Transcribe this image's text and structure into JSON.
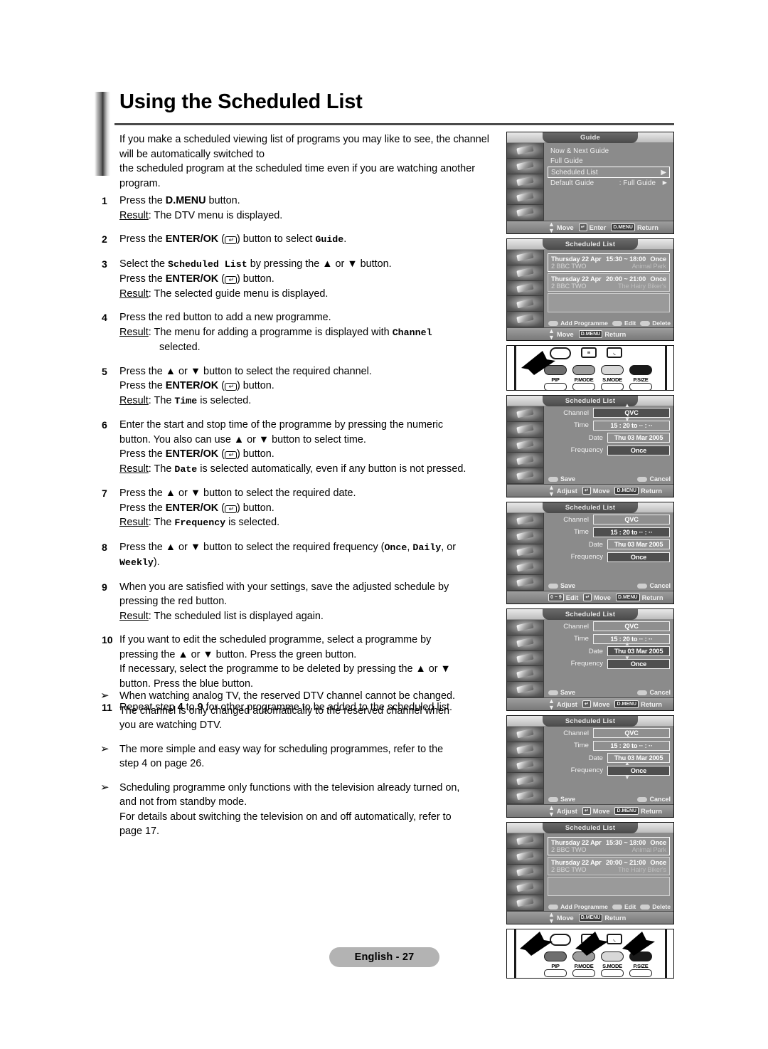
{
  "header": {
    "title": "Using the Scheduled List"
  },
  "intro": {
    "l1": "If you make a scheduled viewing list of programs you may like to see, the channel",
    "l2": "will be automatically switched to",
    "l3": "the scheduled program at the scheduled time even if  you are watching another",
    "l4": "program."
  },
  "steps": [
    {
      "num": "1",
      "lines": [
        {
          "pre": "Press the ",
          "bold": "D.MENU",
          "post": " button."
        },
        {
          "result": "Result",
          "text": ": The DTV menu is displayed."
        }
      ]
    },
    {
      "num": "2",
      "lines": [
        {
          "pre": "Press the ",
          "bold": "ENTER/OK",
          "enter": true,
          "post": " button to select ",
          "mono": "Guide",
          "tail": "."
        }
      ]
    },
    {
      "num": "3",
      "lines": [
        {
          "pre": "Select the ",
          "mono": "Scheduled List",
          "post": " by pressing the ▲ or ▼ button."
        },
        {
          "pre": "Press the ",
          "bold": "ENTER/OK",
          "enter": true,
          "post": " button."
        },
        {
          "result": "Result",
          "text": ": The selected guide menu is displayed."
        }
      ]
    },
    {
      "num": "4",
      "lines": [
        {
          "pre": "Press the red button to add a new programme."
        },
        {
          "result": "Result",
          "text": ": The menu for adding a programme is displayed with ",
          "mono": "Channel"
        },
        {
          "indent": "selected."
        }
      ]
    },
    {
      "num": "5",
      "lines": [
        {
          "pre": "Press the ▲ or ▼ button to select the required channel."
        },
        {
          "pre": "Press the ",
          "bold": "ENTER/OK",
          "enter": true,
          "post": " button."
        },
        {
          "result": "Result",
          "text": ": The ",
          "mono": "Time",
          "tail": " is selected."
        }
      ]
    },
    {
      "num": "6",
      "lines": [
        {
          "pre": "Enter the start and stop time of the programme by pressing the numeric"
        },
        {
          "pre": "button. You also can use ▲ or ▼ button to select time."
        },
        {
          "pre": "Press the ",
          "bold": "ENTER/OK",
          "enter": true,
          "post": " button."
        },
        {
          "result": "Result",
          "text": ": The ",
          "mono": "Date",
          "tail": " is selected automatically, even if any button is not pressed."
        }
      ]
    },
    {
      "num": "7",
      "lines": [
        {
          "pre": "Press the ▲ or ▼ button to select the required date."
        },
        {
          "pre": "Press the ",
          "bold": "ENTER/OK",
          "enter": true,
          "post": " button."
        },
        {
          "result": "Result",
          "text": ": The ",
          "mono": "Frequency",
          "tail": " is selected."
        }
      ]
    },
    {
      "num": "8",
      "lines": [
        {
          "pre": "Press the ▲ or ▼ button to select the required frequency (",
          "mono": "Once",
          "post": ", ",
          "mono2": "Daily",
          "tail": ", or"
        },
        {
          "mono": "Weekly",
          "tail": ")."
        }
      ]
    },
    {
      "num": "9",
      "lines": [
        {
          "pre": "When you are satisfied with your settings, save the adjusted schedule by"
        },
        {
          "pre": "pressing the red button."
        },
        {
          "result": "Result",
          "text": ": The scheduled list is displayed again."
        }
      ]
    },
    {
      "num": "10",
      "lines": [
        {
          "pre": "If you want to edit the scheduled programme, select a programme by"
        },
        {
          "pre": "pressing the ▲ or ▼ button. Press the green button."
        },
        {
          "pre": "If necessary, select the programme to be deleted by pressing the ▲ or ▼"
        },
        {
          "pre": "button. Press the blue button."
        }
      ]
    },
    {
      "num": "11",
      "lines": [
        {
          "pre": "Repeat step ",
          "bold": "4",
          "post": " to ",
          "bold2": "9",
          "tail": " for other programme to be added to the scheduled list."
        }
      ]
    }
  ],
  "notes": [
    {
      "mark": "➢",
      "lines": [
        "When watching analog TV, the reserved DTV channel cannot be changed.",
        "The channel is only changed automatically to the reserved channel when",
        "you are watching DTV."
      ]
    },
    {
      "mark": "➢",
      "lines": [
        "The more simple and easy way for scheduling programmes, refer to the",
        "step 4 on page 26."
      ]
    },
    {
      "mark": "➢",
      "lines": [
        "Scheduling programme only functions with the television already turned on,",
        "and not from standby mode.",
        "For details about switching the television on and off automatically, refer to",
        "page 17."
      ]
    }
  ],
  "footer": {
    "label": "English - 27"
  },
  "panels": {
    "guide": {
      "title": "Guide",
      "items": [
        {
          "label": "Now & Next Guide",
          "value": "",
          "chevron": false,
          "selected": false
        },
        {
          "label": "Full Guide",
          "value": "",
          "chevron": false,
          "selected": false
        },
        {
          "label": "Scheduled List",
          "value": "",
          "chevron": true,
          "selected": true
        },
        {
          "label": "Default Guide",
          "value": ": Full Guide",
          "chevron": true,
          "selected": false
        }
      ],
      "footer": {
        "move": "Move",
        "enter": "Enter",
        "menu_key": "D.MENU",
        "return": "Return"
      }
    },
    "scheduled_list": {
      "title": "Scheduled List",
      "rows": [
        {
          "date": "Thursday 22 Apr",
          "time": "15:30 ~ 18:00",
          "freq": "Once",
          "channel": "2 BBC TWO",
          "programme": "Animal Park"
        },
        {
          "date": "Thursday 22 Apr",
          "time": "20:00 ~ 21:00",
          "freq": "Once",
          "channel": "2 BBC TWO",
          "programme": "The Hairy Biker's"
        }
      ],
      "color_buttons": [
        {
          "label": "Add Programme"
        },
        {
          "label": "Edit"
        },
        {
          "label": "Delete"
        }
      ],
      "footer": {
        "move": "Move",
        "menu_key": "D.MENU",
        "return": "Return"
      }
    },
    "form": {
      "title": "Scheduled List",
      "fields": [
        {
          "label": "Channel",
          "value": "QVC"
        },
        {
          "label": "Time",
          "value": "15 : 20 to ·· : ··"
        },
        {
          "label": "Date",
          "value": "Thu 03 Mar 2005"
        },
        {
          "label": "Frequency",
          "value": "Once"
        }
      ],
      "save": "Save",
      "cancel": "Cancel",
      "footers": {
        "adjust": "Adjust",
        "edit_keys": "Edit",
        "edit_keys_range": "0 ~ 9",
        "move": "Move",
        "menu_key": "D.MENU",
        "return": "Return"
      }
    }
  },
  "remote": {
    "buttons": [
      "PIP",
      "P.MODE",
      "S.MODE",
      "P.SIZE"
    ]
  }
}
